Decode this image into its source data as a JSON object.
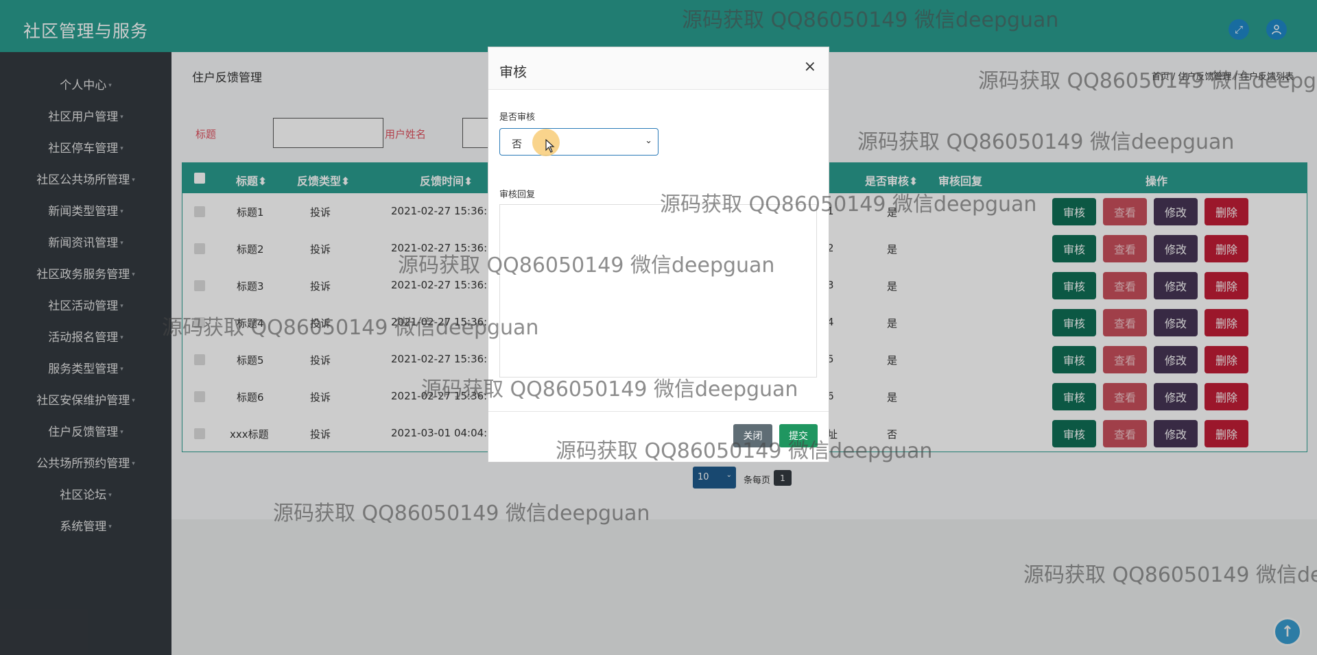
{
  "header": {
    "brand": "社区管理与服务",
    "colors": {
      "header": "#2a9d8f",
      "sidebar": "#343a40"
    }
  },
  "sidebar": {
    "items": [
      {
        "label": "个人中心"
      },
      {
        "label": "社区用户管理"
      },
      {
        "label": "社区停车管理"
      },
      {
        "label": "社区公共场所管理"
      },
      {
        "label": "新闻类型管理"
      },
      {
        "label": "新闻资讯管理"
      },
      {
        "label": "社区政务服务管理"
      },
      {
        "label": "社区活动管理"
      },
      {
        "label": "活动报名管理"
      },
      {
        "label": "服务类型管理"
      },
      {
        "label": "社区安保维护管理"
      },
      {
        "label": "住户反馈管理"
      },
      {
        "label": "公共场所预约管理"
      },
      {
        "label": "社区论坛"
      },
      {
        "label": "系统管理"
      }
    ]
  },
  "page": {
    "title": "住户反馈管理",
    "breadcrumb": "首页 / 住户反馈管理 / 住户反馈列表"
  },
  "search": {
    "title_label": "标题",
    "user_label": "用户姓名"
  },
  "table": {
    "headers": {
      "title": "标题",
      "type": "反馈类型",
      "time": "反馈时间",
      "audited": "是否审核",
      "reply": "审核回复",
      "ops": "操作"
    },
    "rows": [
      {
        "title": "标题1",
        "type": "投诉",
        "time": "2021-02-27 15:36:",
        "col": "1",
        "audited": "是"
      },
      {
        "title": "标题2",
        "type": "投诉",
        "time": "2021-02-27 15:36:",
        "col": "2",
        "audited": "是"
      },
      {
        "title": "标题3",
        "type": "投诉",
        "time": "2021-02-27 15:36:",
        "col": "3",
        "audited": "是"
      },
      {
        "title": "标题4",
        "type": "投诉",
        "time": "2021-02-27 15:36:",
        "col": "4",
        "audited": "是"
      },
      {
        "title": "标题5",
        "type": "投诉",
        "time": "2021-02-27 15:36:",
        "col": "5",
        "audited": "是"
      },
      {
        "title": "标题6",
        "type": "投诉",
        "time": "2021-02-27 15:36:",
        "col": "6",
        "audited": "是"
      },
      {
        "title": "xxx标题",
        "type": "投诉",
        "time": "2021-03-01 04:04:",
        "col": "址",
        "audited": "否"
      }
    ],
    "actions": {
      "audit": "审核",
      "view": "查看",
      "edit": "修改",
      "delete": "删除"
    }
  },
  "pager": {
    "page_size": "10",
    "per_page_text": "条每页",
    "current_page": "1"
  },
  "modal": {
    "title": "审核",
    "close_glyph": "×",
    "audit_label": "是否审核",
    "audit_value": "否",
    "reply_label": "审核回复",
    "reply_value": "",
    "close_button": "关闭",
    "submit_button": "提交"
  },
  "watermark": "源码获取 QQ86050149 微信deepguan"
}
